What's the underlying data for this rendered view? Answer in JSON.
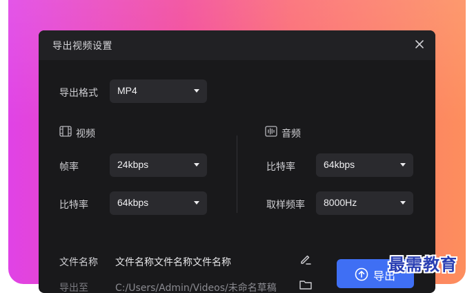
{
  "dialog": {
    "title": "导出视频设置",
    "close_icon": "close-icon"
  },
  "format": {
    "label": "导出格式",
    "value": "MP4"
  },
  "video": {
    "section_label": "视频",
    "icon": "film-icon",
    "frame_rate": {
      "label": "帧率",
      "value": "24kbps"
    },
    "bitrate": {
      "label": "比特率",
      "value": "64kbps"
    }
  },
  "audio": {
    "section_label": "音频",
    "icon": "waveform-icon",
    "bitrate": {
      "label": "比特率",
      "value": "64kbps"
    },
    "sample_rate": {
      "label": "取样频率",
      "value": "8000Hz"
    }
  },
  "file": {
    "name_label": "文件名称",
    "name_value": "文件名称文件名称文件名称",
    "path_label": "导出至",
    "path_value": "C:/Users/Admin/Videos/未命名草稿",
    "edit_icon": "edit-icon",
    "folder_icon": "folder-icon"
  },
  "export_button": {
    "label": "导出",
    "icon": "upload-icon",
    "color": "#3f6ff4"
  },
  "watermark": "最需教育",
  "colors": {
    "dialog_bg": "#19191b",
    "titlebar_bg": "#212124",
    "select_bg": "#2a2a2e",
    "accent": "#3f6ff4",
    "watermark": "#2a3fb3"
  }
}
